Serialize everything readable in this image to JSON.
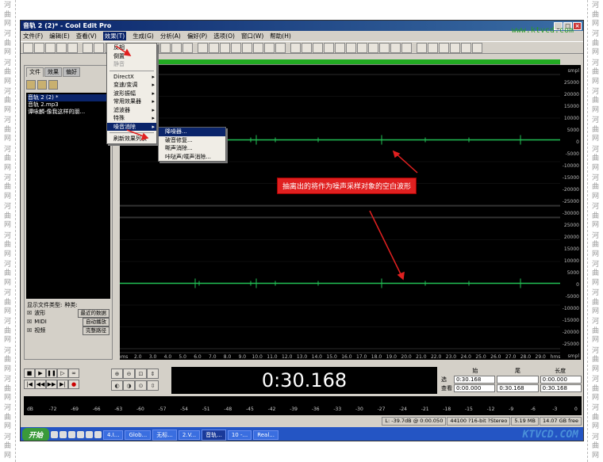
{
  "watermark_side": "河曲网",
  "window": {
    "title": "音轨 2 (2)* - Cool Edit Pro",
    "watermark": "www.ktvcd.com"
  },
  "menubar": [
    "文件(F)",
    "编辑(E)",
    "查看(V)",
    "效果(T)",
    "生成(G)",
    "分析(A)",
    "偏好(P)",
    "选项(O)",
    "窗口(W)",
    "帮助(H)"
  ],
  "panel": {
    "tabs": [
      "文件",
      "效果",
      "偏好"
    ],
    "files": [
      "音轨 2 (2) *",
      "音轨 2.mp3",
      "谭咏麟-像我这样的朋..."
    ],
    "types_label": "显示文件类型:",
    "sort_label": "种类:",
    "sort_value": "最近的数据",
    "types": [
      "波形",
      "MIDI",
      "视频"
    ],
    "auto_play": "自动播放",
    "full_path": "完整路径"
  },
  "effects_menu": [
    {
      "label": "反相",
      "disabled": false,
      "arrow": false
    },
    {
      "label": "倒置",
      "disabled": false,
      "arrow": false
    },
    {
      "label": "静音",
      "disabled": true,
      "arrow": false
    },
    {
      "sep": true
    },
    {
      "label": "DirectX",
      "disabled": false,
      "arrow": true
    },
    {
      "label": "变速/变调",
      "disabled": false,
      "arrow": true
    },
    {
      "label": "波形振幅",
      "disabled": false,
      "arrow": true
    },
    {
      "label": "常用效果器",
      "disabled": false,
      "arrow": true
    },
    {
      "label": "滤波器",
      "disabled": false,
      "arrow": true
    },
    {
      "label": "特殊",
      "disabled": false,
      "arrow": true
    },
    {
      "label": "噪音消除",
      "disabled": false,
      "arrow": true,
      "hl": true
    },
    {
      "sep": true
    },
    {
      "label": "刷新效果列表",
      "disabled": false,
      "arrow": false
    }
  ],
  "noise_submenu": [
    "降噪器...",
    "破音修复...",
    "嘶声消除...",
    "咔哒声/噗声消除..."
  ],
  "annotation": "抽离出的将作为噪声采样对象的空白波形",
  "ruler_labels": [
    "smpl",
    "25000",
    "20000",
    "15000",
    "10000",
    "5000",
    "0",
    "-5000",
    "-10000",
    "-15000",
    "-20000",
    "-25000",
    "-30000",
    "25000",
    "20000",
    "15000",
    "10000",
    "5000",
    "0",
    "-5000",
    "-10000",
    "-15000",
    "-20000",
    "-25000",
    "smpl"
  ],
  "time_axis": [
    "hms",
    "2.0",
    "3.0",
    "4.0",
    "5.0",
    "6.0",
    "7.0",
    "8.0",
    "9.0",
    "10.0",
    "11.0",
    "12.0",
    "13.0",
    "14.0",
    "15.0",
    "16.0",
    "17.0",
    "18.0",
    "19.0",
    "20.0",
    "21.0",
    "22.0",
    "23.0",
    "24.0",
    "25.0",
    "26.0",
    "27.0",
    "28.0",
    "29.0",
    "hms"
  ],
  "time_display": "0:30.168",
  "selection": {
    "headers": [
      "始",
      "尾",
      "长度"
    ],
    "rows": [
      {
        "label": "选",
        "begin": "0:30.168",
        "end": "",
        "length": "0:00.000"
      },
      {
        "label": "查看",
        "begin": "0:00.000",
        "end": "0:30.168",
        "length": "0:30.168"
      }
    ]
  },
  "meter_scale": [
    "dB",
    "-72",
    "-69",
    "-66",
    "-63",
    "-60",
    "-57",
    "-54",
    "-51",
    "-48",
    "-45",
    "-42",
    "-39",
    "-36",
    "-33",
    "-30",
    "-27",
    "-24",
    "-21",
    "-18",
    "-15",
    "-12",
    "-9",
    "-6",
    "-3",
    "0"
  ],
  "status": [
    "L: -39.7dB @  0:00.050",
    "44100 ?16-bit ?Stereo",
    "5.19 MB",
    "14.07 GB free"
  ],
  "taskbar": {
    "start": "开始",
    "tasks": [
      "4.I...",
      "Glob...",
      "无标...",
      "2.V...",
      "音轨...",
      "10 -...",
      "Real..."
    ],
    "watermark": "KTVCD.COM"
  },
  "colors": {
    "accent": "#0a246a",
    "wave": "#22c055",
    "annotation": "#e02020"
  }
}
